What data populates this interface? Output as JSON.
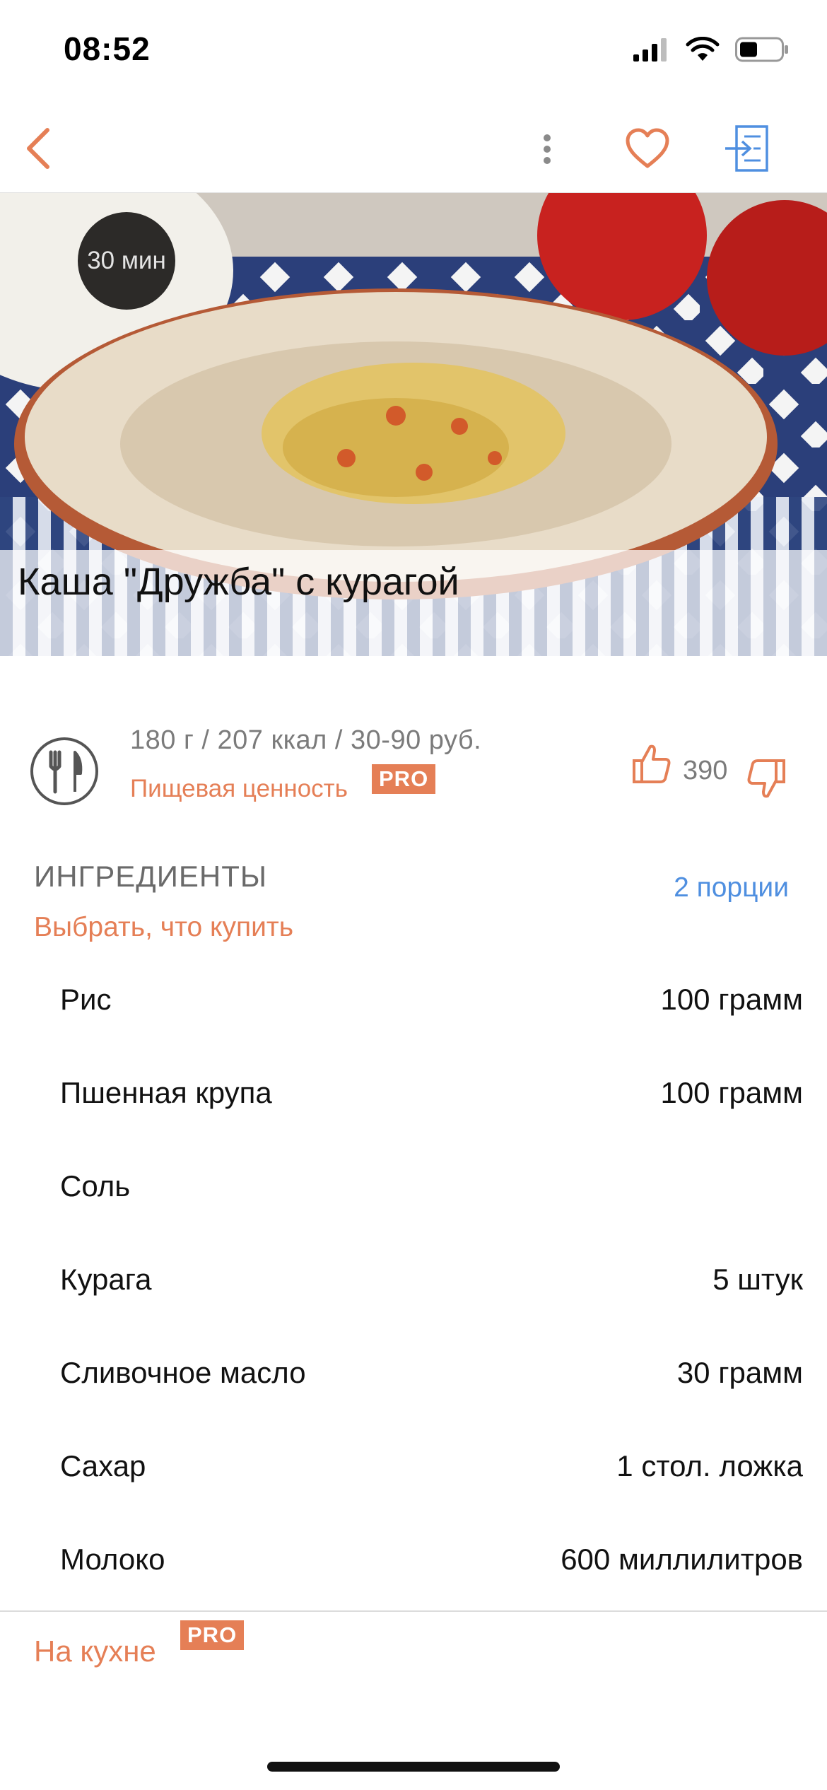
{
  "status_bar": {
    "time": "08:52"
  },
  "hero": {
    "time_badge": "30 мин",
    "title": "Каша \"Дружба\" с курагой"
  },
  "info": {
    "stats": "180 г / 207 ккал / 30-90 руб.",
    "nutrition_link": "Пищевая ценность",
    "pro_label": "PRO",
    "rating": "390"
  },
  "ingredients": {
    "heading": "ИНГРЕДИЕНТЫ",
    "portions": "2 порции",
    "choose_link": "Выбрать, что купить",
    "items": [
      {
        "name": "Рис",
        "qty": "100 грамм"
      },
      {
        "name": "Пшенная крупа",
        "qty": "100 грамм"
      },
      {
        "name": "Соль",
        "qty": ""
      },
      {
        "name": "Курага",
        "qty": "5 штук"
      },
      {
        "name": "Сливочное масло",
        "qty": "30 грамм"
      },
      {
        "name": "Сахар",
        "qty": "1 стол. ложка"
      },
      {
        "name": "Молоко",
        "qty": "600 миллилитров"
      }
    ]
  },
  "footer": {
    "kitchen_link": "На кухне",
    "pro_label": "PRO"
  },
  "colors": {
    "accent": "#e57f56",
    "link_blue": "#4f8fe0",
    "muted": "#7b7b7b"
  },
  "icons": [
    "back-arrow-icon",
    "more-vertical-icon",
    "heart-icon",
    "share-icon",
    "fork-knife-icon",
    "thumbs-up-icon",
    "thumbs-down-icon"
  ]
}
